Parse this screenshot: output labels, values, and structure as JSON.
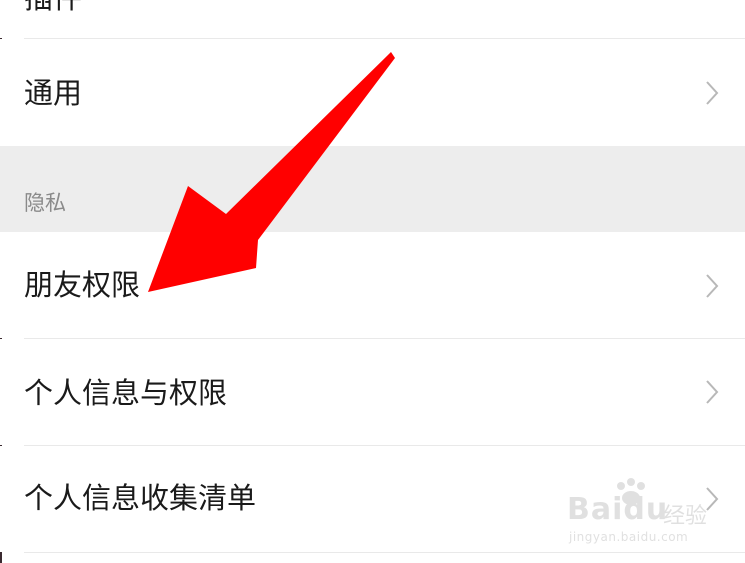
{
  "settings": {
    "top_partial_label": "插件",
    "general_label": "通用",
    "privacy_section_title": "隐私",
    "items": [
      {
        "label": "朋友权限"
      },
      {
        "label": "个人信息与权限"
      },
      {
        "label": "个人信息收集清单"
      }
    ]
  },
  "overlay": {
    "arrow_color": "#ff0000"
  },
  "watermark": {
    "brand": "Baidu",
    "cn": "经验",
    "url": "jingyan.baidu.com"
  },
  "icons": {
    "chevron": "chevron-right-icon"
  }
}
